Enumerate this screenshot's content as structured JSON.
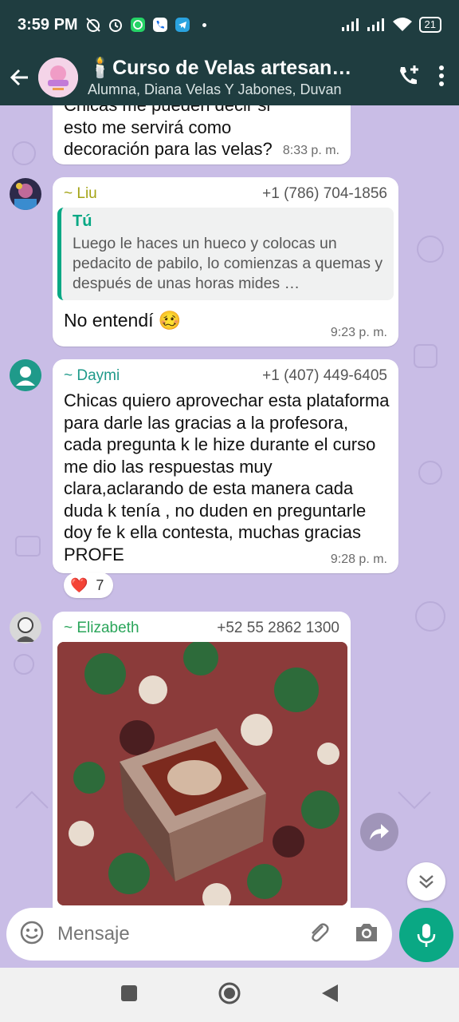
{
  "status_bar": {
    "time": "3:59 PM",
    "battery": "21"
  },
  "header": {
    "title": "🕯️Curso de Velas artesanales",
    "subtitle": "Alumna, Diana Velas Y Jabones, Duvan"
  },
  "messages": {
    "m0": {
      "text": "Chicas me pueden decir si esto me servirá como decoración para las velas?",
      "time": "8:33 p. m."
    },
    "m1": {
      "sender": "~ Liu",
      "phone": "+1 (786) 704-1856",
      "sender_color": "#a3a314",
      "quote_author": "Tú",
      "quote_text": "Luego le haces un hueco y colocas un pedacito de pabilo, lo comienzas a quemas y después de unas horas mides …",
      "text": "No entendí 🥴",
      "time": "9:23 p. m."
    },
    "m2": {
      "sender": "~ Daymi",
      "phone": "+1 (407) 449-6405",
      "sender_color": "#1f9a8a",
      "text": "Chicas quiero aprovechar esta plataforma para darle las gracias a la profesora, cada pregunta k le hize durante el curso me dio las respuestas muy clara,aclarando de esta manera cada duda k tenía , no duden en preguntarle doy fe k ella contesta, muchas gracias PROFE",
      "time": "9:28 p. m.",
      "reaction": {
        "emoji": "❤️",
        "count": "7"
      }
    },
    "m3": {
      "sender": "~ Elizabeth",
      "phone": "+52 55 2862 1300",
      "sender_color": "#2aa55a"
    }
  },
  "composer": {
    "placeholder": "Mensaje"
  },
  "colors": {
    "header_bg": "#1f3d40",
    "chat_bg": "#c9bde6",
    "accent": "#0aa884"
  }
}
